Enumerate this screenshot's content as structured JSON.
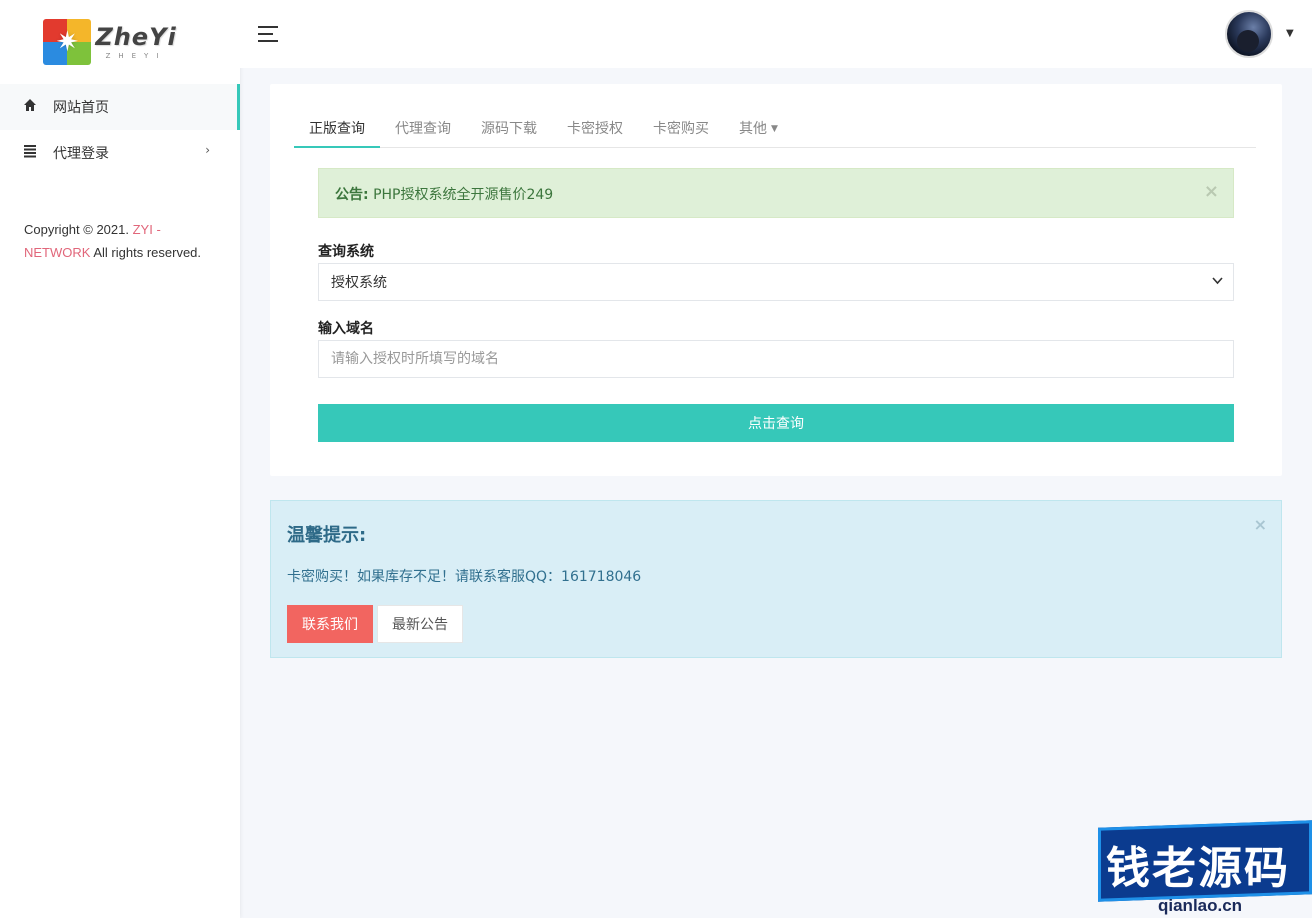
{
  "sidebar": {
    "logo": {
      "title": "ZheYi",
      "subtitle": "ZHEYI"
    },
    "items": [
      {
        "label": "网站首页",
        "icon": "home-icon",
        "active": true
      },
      {
        "label": "代理登录",
        "icon": "list-icon",
        "active": false
      }
    ],
    "copyright": {
      "prefix": "Copyright © 2021.",
      "link": "ZYI - NETWORK",
      "suffix": "All rights reserved."
    }
  },
  "header": {
    "menu_icon": "hamburger-icon",
    "avatar_icon": "avatar",
    "caret_icon": "caret-down-icon"
  },
  "tabs": [
    {
      "label": "正版查询",
      "active": true
    },
    {
      "label": "代理查询"
    },
    {
      "label": "源码下载"
    },
    {
      "label": "卡密授权"
    },
    {
      "label": "卡密购买"
    },
    {
      "label": "其他",
      "dropdown": true
    }
  ],
  "notice": {
    "label": "公告:",
    "text": "PHP授权系统全开源售价249",
    "close": "×"
  },
  "form": {
    "system_label": "查询系统",
    "system_value": "授权系统",
    "domain_label": "输入域名",
    "domain_placeholder": "请输入授权时所填写的域名",
    "submit_label": "点击查询"
  },
  "tip": {
    "title": "温馨提示:",
    "text": "卡密购买！如果库存不足！请联系客服QQ：161718046",
    "close": "×",
    "contact_label": "联系我们",
    "news_label": "最新公告"
  },
  "watermark": {
    "text": "钱老源码",
    "url": "qianlao.cn"
  },
  "colors": {
    "accent": "#36c8b9",
    "notice_bg": "#dff0d8",
    "tip_bg": "#d9eef6",
    "danger": "#f26560",
    "link": "#e1667a"
  }
}
